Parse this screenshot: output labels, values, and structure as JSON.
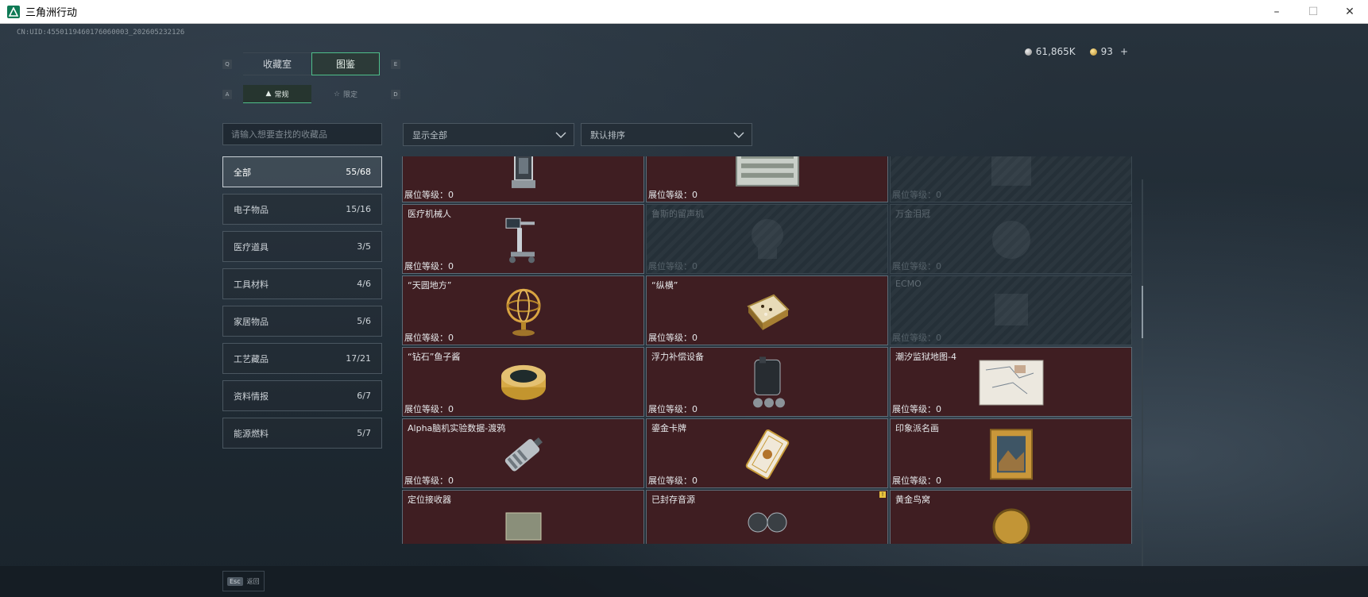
{
  "window": {
    "title": "三角洲行动",
    "minimize_icon": "minimize-icon",
    "maximize_icon": "maximize-icon",
    "close_icon": "close-icon"
  },
  "header": {
    "uid": "CN:UID:4550119460176060003_202605232126",
    "currency": [
      {
        "icon": "silver-coin-icon",
        "value": "61,865K"
      },
      {
        "icon": "gold-coin-icon",
        "value": "93",
        "add": "+"
      }
    ]
  },
  "tabs": {
    "prev_key": "Q",
    "next_key": "E",
    "items": [
      {
        "label": "收藏室",
        "active": false
      },
      {
        "label": "图鉴",
        "active": true
      }
    ]
  },
  "subtabs": {
    "prev_key": "A",
    "next_key": "D",
    "items": [
      {
        "label": "常规",
        "icon": "flask-icon",
        "active": true
      },
      {
        "label": "限定",
        "icon": "star-icon",
        "active": false
      }
    ]
  },
  "search": {
    "placeholder": "请输入想要查找的收藏品"
  },
  "filters": {
    "display": "显示全部",
    "sort": "默认排序"
  },
  "categories": [
    {
      "label": "全部",
      "count": "55/68",
      "active": true
    },
    {
      "label": "电子物品",
      "count": "15/16"
    },
    {
      "label": "医疗道具",
      "count": "3/5"
    },
    {
      "label": "工具材料",
      "count": "4/6"
    },
    {
      "label": "家居物品",
      "count": "5/6"
    },
    {
      "label": "工艺藏品",
      "count": "17/21"
    },
    {
      "label": "资料情报",
      "count": "6/7"
    },
    {
      "label": "能源燃料",
      "count": "5/7"
    }
  ],
  "level_label": "展位等级：",
  "items": [
    {
      "name": "",
      "level": "0",
      "locked": false,
      "icon": "display-case-icon"
    },
    {
      "name": "",
      "level": "0",
      "locked": false,
      "icon": "server-cabinet-icon"
    },
    {
      "name": "",
      "level": "0",
      "locked": true,
      "icon": "unknown-item-icon"
    },
    {
      "name": "医疗机械人",
      "level": "0",
      "locked": false,
      "icon": "medical-robot-icon"
    },
    {
      "name": "鲁斯的留声机",
      "level": "0",
      "locked": true,
      "icon": "gramophone-icon"
    },
    {
      "name": "万金泪冠",
      "level": "0",
      "locked": true,
      "icon": "crown-icon"
    },
    {
      "name": "“天圆地方”",
      "level": "0",
      "locked": false,
      "icon": "armillary-sphere-icon"
    },
    {
      "name": "“纵横”",
      "level": "0",
      "locked": false,
      "icon": "chessboard-icon"
    },
    {
      "name": "ECMO",
      "level": "0",
      "locked": true,
      "icon": "ecmo-machine-icon"
    },
    {
      "name": "“钻石”鱼子酱",
      "level": "0",
      "locked": false,
      "icon": "caviar-tin-icon"
    },
    {
      "name": "浮力补偿设备",
      "level": "0",
      "locked": false,
      "icon": "buoyancy-device-icon"
    },
    {
      "name": "潮汐监狱地图-4",
      "level": "0",
      "locked": false,
      "icon": "prison-map-icon"
    },
    {
      "name": "Alpha脑机实验数据-渡鸦",
      "level": "0",
      "locked": false,
      "icon": "data-drive-icon"
    },
    {
      "name": "鎏金卡牌",
      "level": "0",
      "locked": false,
      "icon": "gilded-card-icon"
    },
    {
      "name": "印象派名画",
      "level": "0",
      "locked": false,
      "icon": "framed-painting-icon"
    },
    {
      "name": "定位接收器",
      "level": "",
      "locked": false,
      "icon": "receiver-icon"
    },
    {
      "name": "已封存音源",
      "level": "",
      "locked": false,
      "icon": "audio-reel-icon",
      "alert": "!"
    },
    {
      "name": "黄金鸟窝",
      "level": "",
      "locked": false,
      "icon": "golden-nest-icon"
    }
  ],
  "footer": {
    "esc_key": "Esc",
    "back_label": "返回"
  },
  "colors": {
    "accent": "#4fbf8a",
    "card_bg": "#3f1e22",
    "locked_bg": "#253038"
  }
}
